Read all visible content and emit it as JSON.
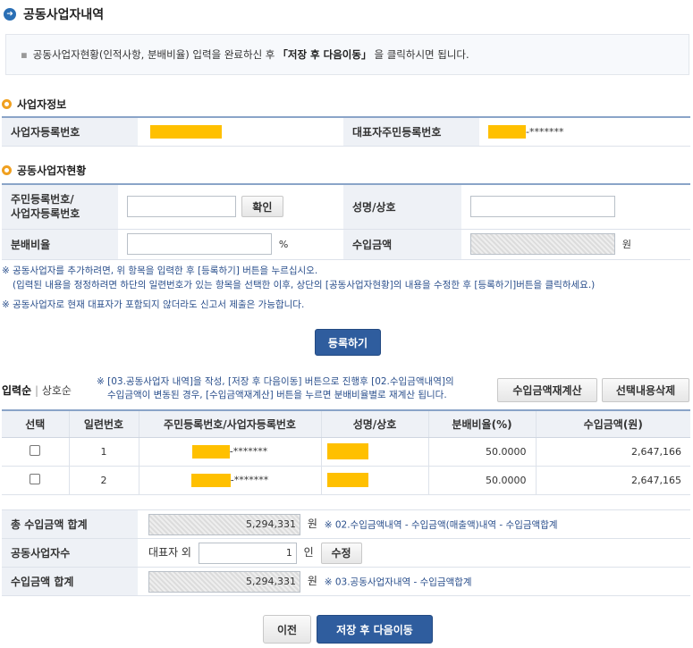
{
  "page": {
    "title": "공동사업자내역",
    "notice_prefix": "공동사업자현황(인적사항, 분배비율) 입력을 완료하신 후",
    "notice_emph": "「저장 후 다음이동」",
    "notice_suffix": "을 클릭하시면 됩니다."
  },
  "business_info": {
    "heading": "사업자정보",
    "reg_no_label": "사업자등록번호",
    "rep_id_label": "대표자주민등록번호",
    "rep_id_masked": "-*******"
  },
  "partner_form": {
    "heading": "공동사업자현황",
    "id_label_line1": "주민등록번호/",
    "id_label_line2": "사업자등록번호",
    "confirm_label": "확인",
    "name_label": "성명/상호",
    "ratio_label": "분배비율",
    "ratio_unit": "%",
    "income_label": "수입금액",
    "income_unit": "원",
    "hint1": "※ 공동사업자를 추가하려면, 위 항목을 입력한 후 [등록하기] 버튼을 누르십시오.",
    "hint2": "(입력된 내용을 정정하려면 하단의 일련번호가 있는 항목을 선택한 이후, 상단의 [공동사업자현황]의 내용을 수정한 후 [등록하기]버튼을 클릭하세요.)",
    "hint3": "※ 공동사업자로 현재 대표자가 포함되지 않더라도 신고서 제출은 가능합니다.",
    "register_label": "등록하기"
  },
  "list": {
    "sort_input": "입력순",
    "sort_name": "상호순",
    "note_line1": "※ [03.공동사업자 내역]을 작성, [저장 후 다음이동] 버튼으로 진행후 [02.수입금액내역]의",
    "note_line2": "수입금액이 변동된 경우, [수입금액재계산] 버튼을 누르면 분배비율별로 재계산 됩니다.",
    "recalc_label": "수입금액재계산",
    "delete_label": "선택내용삭제",
    "columns": [
      "선택",
      "일련번호",
      "주민등록번호/사업자등록번호",
      "성명/상호",
      "분배비율(%)",
      "수입금액(원)"
    ],
    "rows": [
      {
        "seq": "1",
        "id_masked": "-*******",
        "ratio": "50.0000",
        "income": "2,647,166"
      },
      {
        "seq": "2",
        "id_masked": "-*******",
        "ratio": "50.0000",
        "income": "2,647,165"
      }
    ]
  },
  "summary": {
    "total_label": "총 수입금액 합계",
    "total_value": "5,294,331",
    "total_unit": "원",
    "total_note": "※ 02.수입금액내역 - 수입금액(매출액)내역 - 수입금액합계",
    "count_label": "공동사업자수",
    "count_prefix": "대표자 외",
    "count_value": "1",
    "count_unit": "인",
    "edit_label": "수정",
    "sum_label": "수입금액 합계",
    "sum_value": "5,294,331",
    "sum_unit": "원",
    "sum_note": "※ 03.공동사업자내역 - 수입금액합계"
  },
  "footer": {
    "prev_label": "이전",
    "next_label": "저장 후 다음이동"
  }
}
